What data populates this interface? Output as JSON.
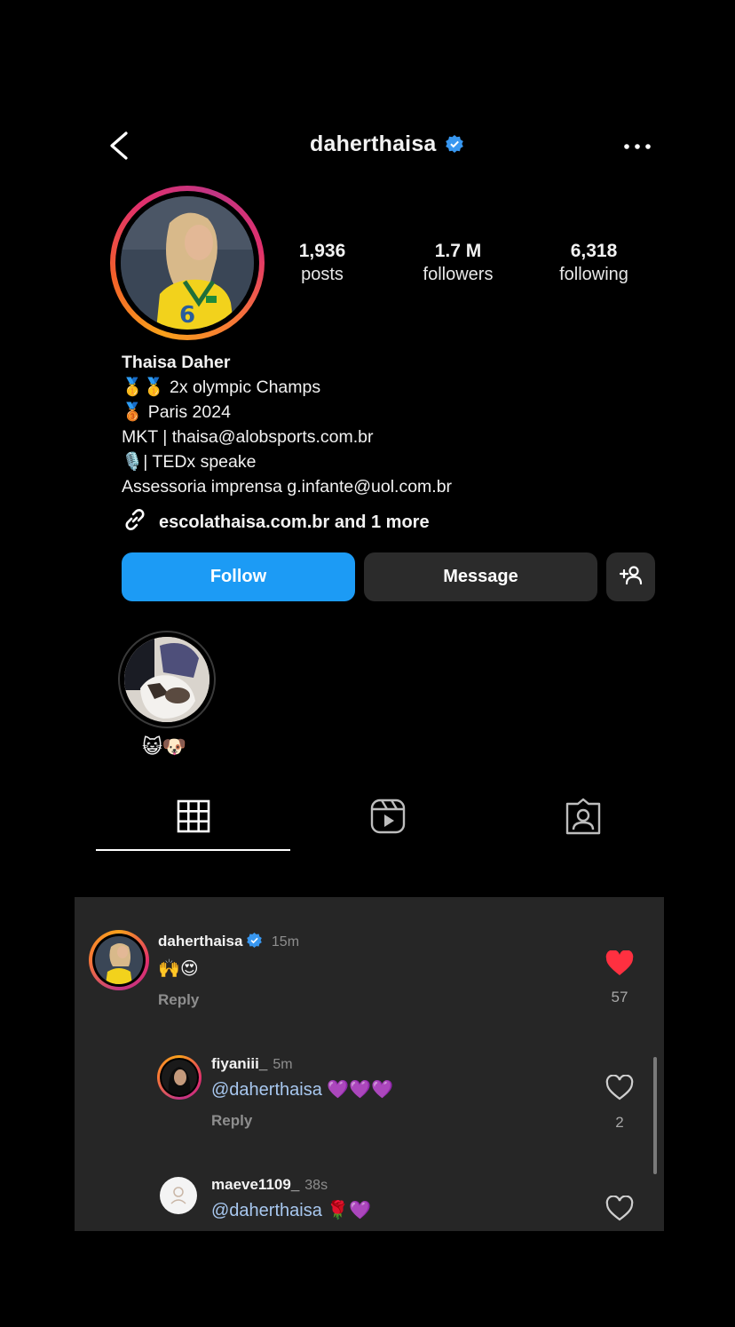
{
  "header": {
    "username": "daherthaisa"
  },
  "profile": {
    "stats": [
      {
        "value": "1,936",
        "label": "posts"
      },
      {
        "value": "1.7 M",
        "label": "followers"
      },
      {
        "value": "6,318",
        "label": "following"
      }
    ],
    "name": "Thaisa Daher",
    "bio_lines": [
      "🥇🥇 2x olympic Champs",
      "🥉 Paris 2024",
      "MKT | thaisa@alobsports.com.br",
      "🎙️| TEDx speake",
      "Assessoria imprensa g.infante@uol.com.br"
    ],
    "link": "escolathaisa.com.br and 1 more"
  },
  "actions": {
    "follow_label": "Follow",
    "message_label": "Message"
  },
  "highlights": [
    {
      "label": "😺🐶"
    }
  ],
  "tabs": [
    "grid-icon",
    "reels-icon",
    "tagged-icon"
  ],
  "comments": [
    {
      "user": "daherthaisa",
      "time": "15m",
      "text": "🙌😍",
      "reply": "Reply",
      "likes": "57",
      "liked": true
    },
    {
      "user": "fiyaniii_",
      "time": "5m",
      "mention": "@daherthaisa",
      "text": "💜💜💜",
      "reply": "Reply",
      "likes": "2",
      "liked": false
    },
    {
      "user": "maeve1109_",
      "time": "38s",
      "mention": "@daherthaisa",
      "text": "🌹💜",
      "liked": false
    }
  ],
  "colors": {
    "follow": "#1c9bf5",
    "verified": "#3897f0",
    "like": "#ff3040",
    "panel": "#262626"
  }
}
